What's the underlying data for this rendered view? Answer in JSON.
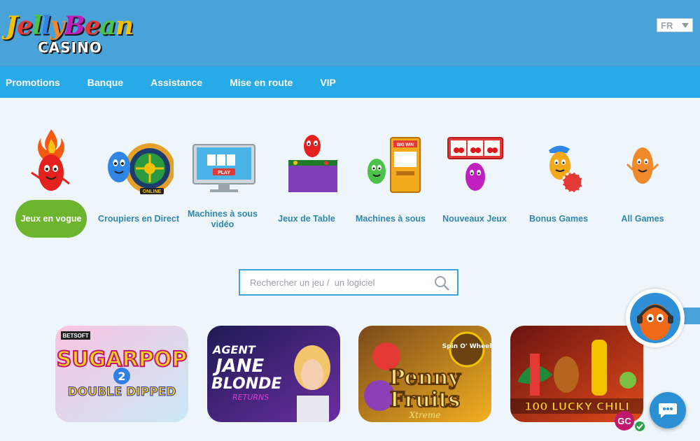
{
  "brand": {
    "logo_top": "JellyBean",
    "logo_bottom": "CASINO"
  },
  "language": {
    "selected": "FR"
  },
  "nav": [
    "Promotions",
    "Banque",
    "Assistance",
    "Mise en route",
    "VIP"
  ],
  "categories": [
    {
      "label": "Jeux en vogue",
      "active": true
    },
    {
      "label": "Croupiers en Direct",
      "active": false
    },
    {
      "label": "Machines à sous vidéo",
      "active": false
    },
    {
      "label": "Jeux de Table",
      "active": false
    },
    {
      "label": "Machines à sous",
      "active": false
    },
    {
      "label": "Nouveaux Jeux",
      "active": false
    },
    {
      "label": "Bonus Games",
      "active": false
    },
    {
      "label": "All Games",
      "active": false
    }
  ],
  "category_art_text": {
    "online": "ONLINE",
    "play": "PLAY",
    "big_win": "BIG WIN"
  },
  "search": {
    "placeholder": "Rechercher un jeu /  un logiciel"
  },
  "games": [
    {
      "provider": "BETSOFT",
      "title_lines": [
        "SUGARPOP",
        "2",
        "DOUBLE DIPPED"
      ],
      "colors": [
        "#f9c4e0",
        "#c9e9f6"
      ]
    },
    {
      "title_lines": [
        "AGENT",
        "JANE",
        "BLONDE",
        "RETURNS"
      ],
      "colors": [
        "#1e1a55",
        "#6b2fa1"
      ]
    },
    {
      "badge": "Spin O' Wheel",
      "title_lines": [
        "Penny",
        "Fruits",
        "Xtreme"
      ],
      "colors": [
        "#7a4a1a",
        "#f2b020"
      ]
    },
    {
      "title_lines": [
        "100 LUCKY CHILI"
      ],
      "colors": [
        "#6b1410",
        "#e04a1a"
      ]
    }
  ],
  "gc_badge": "GC"
}
